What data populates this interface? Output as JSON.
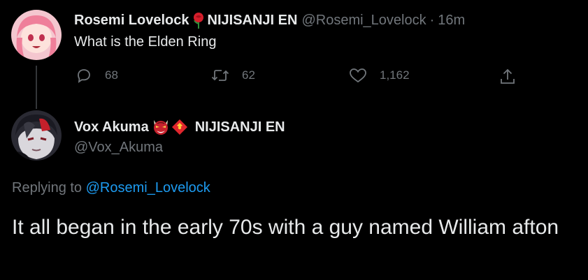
{
  "parent_tweet": {
    "display_name": "Rosemi Lovelock",
    "affiliation": "NIJISANJI EN",
    "handle": "@Rosemi_Lovelock",
    "separator": "·",
    "time": "16m",
    "text": "What is the Elden Ring",
    "actions": {
      "replies": "68",
      "retweets": "62",
      "likes": "1,162"
    }
  },
  "main_tweet": {
    "display_name": "Vox Akuma",
    "affiliation": "NIJISANJI EN",
    "handle": "@Vox_Akuma",
    "replying_prefix": "Replying to",
    "replying_to": "@Rosemi_Lovelock",
    "text": "It all began in the early 70s with a guy named William afton"
  },
  "icons": [
    "avatar-rosemi",
    "rose-icon",
    "reply-icon",
    "retweet-icon",
    "like-icon",
    "share-icon",
    "avatar-vox",
    "oni-mask-icon",
    "red-envelope-icon"
  ],
  "colors": {
    "background": "#000000",
    "text": "#e7e9ea",
    "muted": "#71767b",
    "link": "#1d9bf0"
  }
}
